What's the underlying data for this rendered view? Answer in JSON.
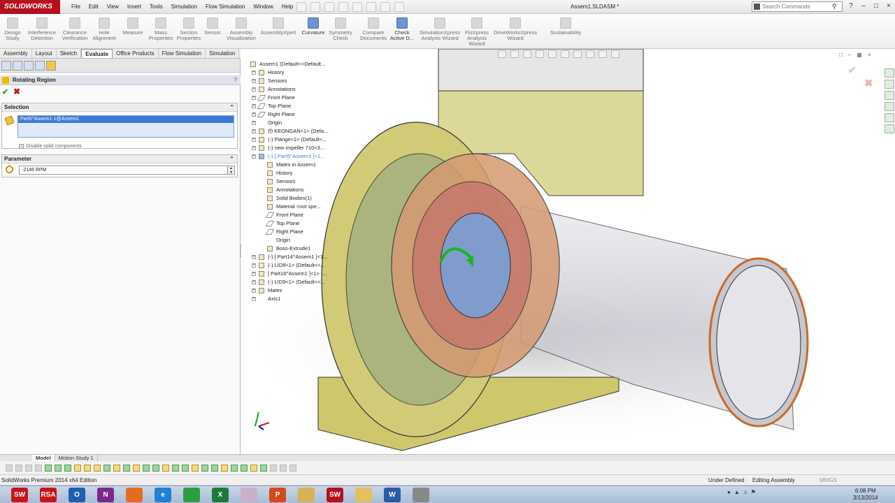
{
  "app": {
    "brand": "SOLIDWORKS",
    "doc_title": "Assem1.SLDASM *",
    "menus": [
      "File",
      "Edit",
      "View",
      "Insert",
      "Tools",
      "Simulation",
      "Flow Simulation",
      "Window",
      "Help"
    ],
    "search_placeholder": "Search Commands",
    "accent_color": "#b5101d"
  },
  "ribbon": [
    {
      "label": "Design Study",
      "icon": "design-study-icon"
    },
    {
      "label": "Interference Detection",
      "icon": "interference-icon"
    },
    {
      "label": "Clearance Verification",
      "icon": "clearance-icon"
    },
    {
      "label": "Hole Alignment",
      "icon": "hole-alignment-icon"
    },
    {
      "label": "Measure",
      "icon": "measure-icon"
    },
    {
      "label": "Mass Properties",
      "icon": "mass-properties-icon"
    },
    {
      "label": "Section Properties",
      "icon": "section-properties-icon"
    },
    {
      "label": "Sensor",
      "icon": "sensor-icon"
    },
    {
      "label": "Assembly Visualization",
      "icon": "assembly-visualization-icon"
    },
    {
      "label": "AssemblyXpert",
      "icon": "assemblyxpert-icon"
    },
    {
      "label": "Curvature",
      "icon": "curvature-icon"
    },
    {
      "label": "Symmetry Check",
      "icon": "symmetry-icon"
    },
    {
      "label": "Compare Documents",
      "icon": "compare-icon"
    },
    {
      "label": "Check Active D...",
      "icon": "check-icon"
    },
    {
      "label": "SimulationXpress Analysis Wizard",
      "icon": "simulationxpress-icon"
    },
    {
      "label": "FloXpress Analysis Wizard",
      "icon": "floxpress-icon"
    },
    {
      "label": "DriveWorksXpress Wizard",
      "icon": "driveworks-icon"
    },
    {
      "label": "Sustainability",
      "icon": "sustainability-icon"
    }
  ],
  "cm_tabs": [
    "Assembly",
    "Layout",
    "Sketch",
    "Evaluate",
    "Office Products",
    "Flow Simulation",
    "Simulation"
  ],
  "cm_selected": "Evaluate",
  "property_manager": {
    "title": "Rotating Region",
    "help": "?",
    "ok": "✔",
    "cancel": "✖",
    "selection_title": "Selection",
    "selection_item": "Part5^Assem1-1@Assem1",
    "disable_label": "Disable solid components",
    "parameter_title": "Parameter",
    "rpm_value": "-2146 RPM"
  },
  "tree": [
    {
      "label": "Assem1  (Default<<Default...",
      "depth": 0,
      "icon": "assembly-icon"
    },
    {
      "label": "History",
      "depth": 1,
      "icon": "history-icon"
    },
    {
      "label": "Sensors",
      "depth": 1,
      "icon": "sensors-icon"
    },
    {
      "label": "Annotations",
      "depth": 1,
      "icon": "annotations-icon"
    },
    {
      "label": "Front Plane",
      "depth": 1,
      "icon": "plane-icon"
    },
    {
      "label": "Top Plane",
      "depth": 1,
      "icon": "plane-icon"
    },
    {
      "label": "Right Plane",
      "depth": 1,
      "icon": "plane-icon"
    },
    {
      "label": "Origin",
      "depth": 1,
      "icon": "origin-icon"
    },
    {
      "label": "(f) KEONGAN<1> (Defa...",
      "depth": 1,
      "icon": "part-icon"
    },
    {
      "label": "(-) Flange<1> (Default<...",
      "depth": 1,
      "icon": "part-icon"
    },
    {
      "label": "(-) new impeller 710<3...",
      "depth": 1,
      "icon": "part-icon"
    },
    {
      "label": "(-) [ Part5^Assem1 ]<1...",
      "depth": 1,
      "icon": "part-icon",
      "selected": true
    },
    {
      "label": "Mates in Assem1",
      "depth": 2,
      "icon": "mates-icon"
    },
    {
      "label": "History",
      "depth": 2,
      "icon": "history-icon"
    },
    {
      "label": "Sensors",
      "depth": 2,
      "icon": "sensors-icon"
    },
    {
      "label": "Annotations",
      "depth": 2,
      "icon": "annotations-icon"
    },
    {
      "label": "Solid Bodies(1)",
      "depth": 2,
      "icon": "solid-bodies-icon"
    },
    {
      "label": "Material <not spe...",
      "depth": 2,
      "icon": "material-icon"
    },
    {
      "label": "Front Plane",
      "depth": 2,
      "icon": "plane-icon"
    },
    {
      "label": "Top Plane",
      "depth": 2,
      "icon": "plane-icon"
    },
    {
      "label": "Right Plane",
      "depth": 2,
      "icon": "plane-icon"
    },
    {
      "label": "Origin",
      "depth": 2,
      "icon": "origin-icon"
    },
    {
      "label": "Boss-Extrude1",
      "depth": 2,
      "icon": "extrude-icon"
    },
    {
      "label": "(-) [ Part14^Assem1 ]<1...",
      "depth": 1,
      "icon": "part-icon"
    },
    {
      "label": "(-) LID8<1> (Default<<...",
      "depth": 1,
      "icon": "part-icon"
    },
    {
      "label": "[ Part16^Assem1 ]<1> -...",
      "depth": 1,
      "icon": "part-icon"
    },
    {
      "label": "(-) LID9<1> (Default<<...",
      "depth": 1,
      "icon": "part-icon"
    },
    {
      "label": "Mates",
      "depth": 1,
      "icon": "mates-icon"
    },
    {
      "label": "Axis1",
      "depth": 1,
      "icon": "axis-icon"
    }
  ],
  "model_tabs": [
    "Model",
    "Motion Study 1"
  ],
  "status": {
    "product": "SolidWorks Premium 2014 x64 Edition",
    "definition": "Under Defined",
    "mode": "Editing Assembly",
    "units": "MMGS"
  },
  "taskbar": {
    "apps": [
      "SolidWorks",
      "RSA",
      "Outlook",
      "OneNote",
      "Firefox",
      "Internet Explorer",
      "Chrome",
      "Excel",
      "App",
      "PowerPoint",
      "Files",
      "SolidWorks",
      "Explorer",
      "Word",
      "Tool"
    ],
    "time": "6:08 PM",
    "date": "3/13/2014"
  }
}
